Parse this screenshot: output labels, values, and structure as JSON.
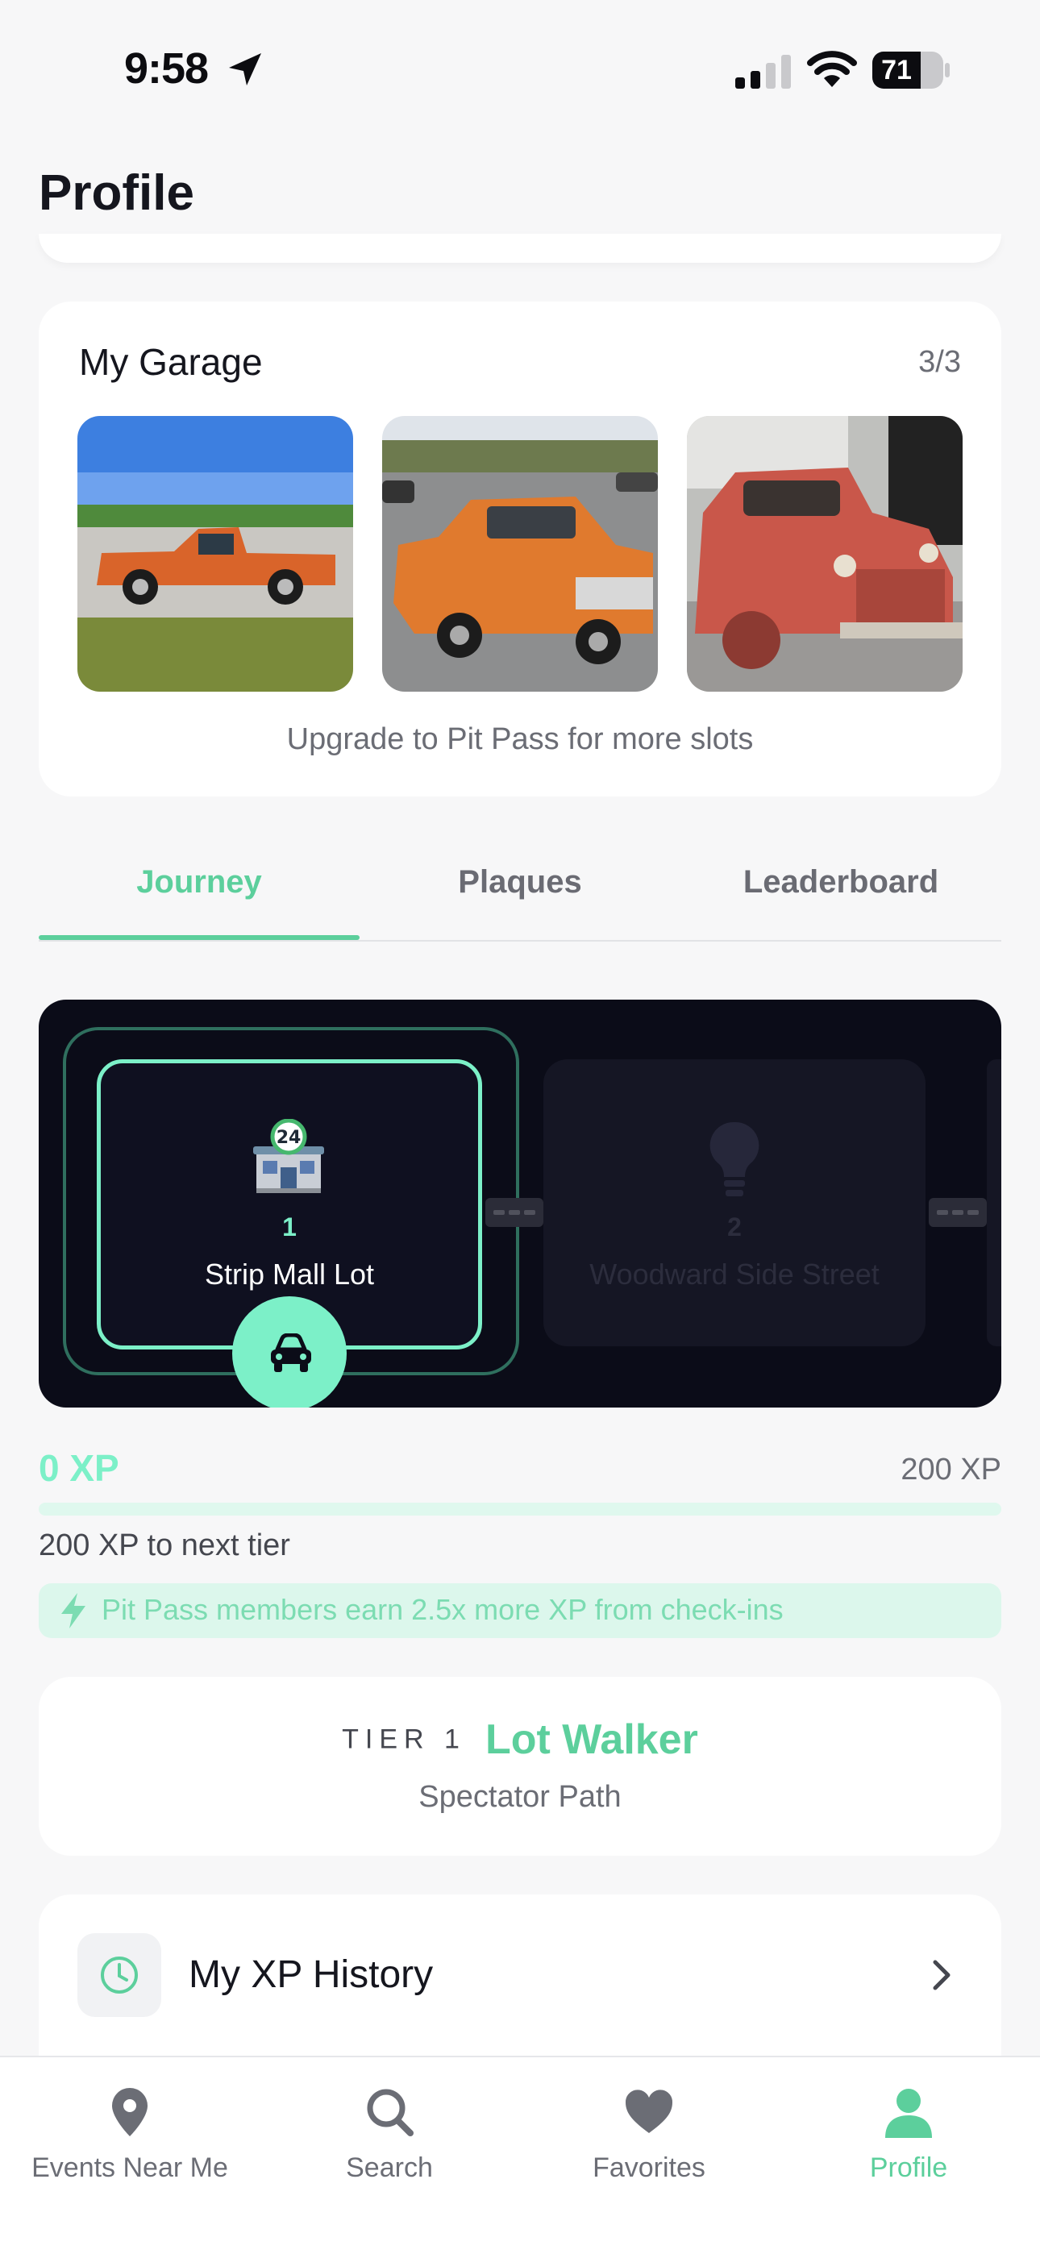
{
  "status_bar": {
    "time": "9:58",
    "battery": "71"
  },
  "page": {
    "title": "Profile"
  },
  "garage": {
    "title": "My Garage",
    "count": "3/3",
    "upgrade_hint": "Upgrade to Pit Pass for more slots",
    "photos": [
      "orange-chevy-pickup-photo",
      "orange-gmc-pickup-photo",
      "red-rusty-dodge-pickup-photo"
    ]
  },
  "tabs": [
    {
      "label": "Journey",
      "active": true
    },
    {
      "label": "Plaques",
      "active": false
    },
    {
      "label": "Leaderboard",
      "active": false
    }
  ],
  "journey": {
    "current": {
      "number": "1",
      "name": "Strip Mall Lot"
    },
    "next": {
      "number": "2",
      "name": "Woodward Side Street"
    }
  },
  "xp": {
    "current": "0 XP",
    "goal": "200 XP",
    "progress_fraction": 0,
    "to_next": "200 XP to next tier",
    "promo": "Pit Pass members earn 2.5x more XP from check-ins"
  },
  "tier": {
    "label": "TIER 1",
    "title": "Lot Walker",
    "path": "Spectator Path"
  },
  "history": {
    "label": "My XP History"
  },
  "nav": [
    {
      "label": "Events Near Me",
      "icon": "map-pin-icon"
    },
    {
      "label": "Search",
      "icon": "search-icon"
    },
    {
      "label": "Favorites",
      "icon": "heart-icon"
    },
    {
      "label": "Profile",
      "icon": "person-icon",
      "active": true
    }
  ],
  "colors": {
    "accent": "#5ccf9c",
    "accent_light": "#7cf0c8",
    "journey_bg": "#0b0c18"
  }
}
